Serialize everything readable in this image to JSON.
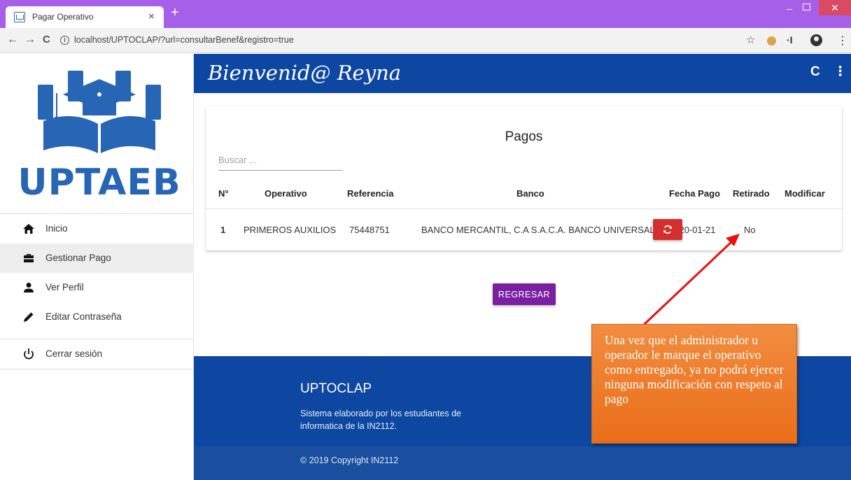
{
  "browser": {
    "tab_title": "Pagar Operativo",
    "tab_close": "×",
    "new_tab": "+",
    "url": "localhost/UPTOCLAP/?url=consultarBenef&registro=true",
    "back": "←",
    "forward": "→",
    "reload": "C",
    "info": "i",
    "star": "☆",
    "menu": "⋮",
    "extension": "·I"
  },
  "sidebar": {
    "logo_text": "UPTAEB",
    "brand_color": "#2766b5",
    "items": [
      {
        "label": "Inicio",
        "icon": "home-icon"
      },
      {
        "label": "Gestionar Pago",
        "icon": "briefcase-icon"
      },
      {
        "label": "Ver Perfil",
        "icon": "person-icon"
      },
      {
        "label": "Editar Contraseña",
        "icon": "pencil-icon"
      },
      {
        "label": "Cerrar sesión",
        "icon": "power-icon"
      }
    ]
  },
  "header": {
    "welcome": "Bienvenid@ Reyna",
    "refresh_glyph": "C",
    "more_glyph": "⋮",
    "color": "#0d47a1"
  },
  "card": {
    "title": "Pagos",
    "search_placeholder": "Buscar ...",
    "columns": [
      "N°",
      "Operativo",
      "Referencia",
      "Banco",
      "Fecha Pago",
      "Retirado",
      "Modificar"
    ],
    "rows": [
      {
        "n": "1",
        "operativo": "PRIMEROS AUXILIOS",
        "referencia": "75448751",
        "banco": "BANCO MERCANTIL, C.A S.A.C.A. BANCO UNIVERSAL",
        "fecha": "2020-01-21",
        "retirado": "No"
      }
    ],
    "modify_button_color": "#d32f2f"
  },
  "back_button": {
    "label": "REGRESAR",
    "color": "#7b1fa2"
  },
  "footer": {
    "title": "UPTOCLAP",
    "text": "Sistema elaborado por los estudiantes de informatica de la IN2112.",
    "copyright": "© 2019 Copyright IN2112"
  },
  "annotation": {
    "text": "Una vez que el administrador u operador le marque el operativo como entregado, ya no podrá ejercer ninguna modificación con respeto al pago",
    "arrow_color": "#e81010",
    "box_color": "#ee7a2a"
  }
}
